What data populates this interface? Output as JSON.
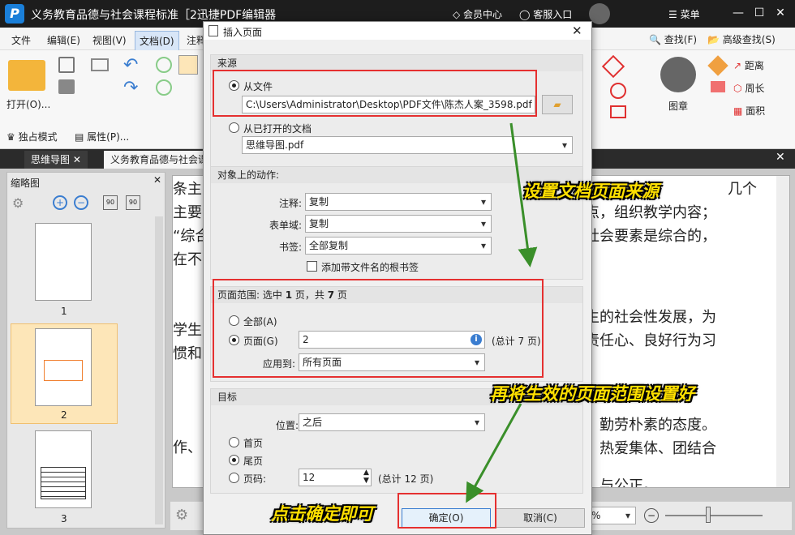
{
  "window": {
    "title": "义务教育品德与社会课程标准［2迅捷PDF编辑器",
    "vip_center": "会员中心",
    "service": "客服入口",
    "menu_label": "菜单"
  },
  "menubar": {
    "items": [
      "文件",
      "编辑(E)",
      "视图(V)",
      "文档(D)",
      "注释"
    ]
  },
  "ribbon": {
    "open_label": "打开(O)...",
    "solo_mode": "独占模式",
    "properties": "属性(P)...",
    "stamp_label": "图章",
    "find": "查找(F)",
    "advanced_find": "高级查找(S)",
    "distance": "距离",
    "perimeter": "周长",
    "area": "面积"
  },
  "tabs": [
    "思维导图",
    "义务教育品德与社会课"
  ],
  "left_pane": {
    "title": "缩略图",
    "pages": [
      "1",
      "2",
      "3"
    ]
  },
  "document_lines": [
    "条主",
    "主要",
    "“综合",
    "在不",
    "学生",
    "惯和",
    "作、"
  ],
  "document_right_lines": [
    "几个",
    "点，组织教学内容；",
    "社会要素是综合的，",
    "生的社会性发展，为",
    "责任心、良好行为习",
    "勤劳朴素的态度。",
    "热爱集体、团结合",
    "与公正。"
  ],
  "status": {
    "zoom": "%"
  },
  "dialog": {
    "title": "插入页面",
    "source_group": "来源",
    "from_file": "从文件",
    "file_path": "C:\\Users\\Administrator\\Desktop\\PDF文件\\陈杰人案_3598.pdf",
    "from_open_doc": "从已打开的文档",
    "open_doc_value": "思维导图.pdf",
    "actions_group": "对象上的动作:",
    "annotation_label": "注释:",
    "annotation_value": "复制",
    "form_label": "表单域:",
    "form_value": "复制",
    "bookmark_label": "书签:",
    "bookmark_value": "全部复制",
    "root_bookmark": "添加带文件名的根书签",
    "range_prefix": "页面范围: 选中",
    "range_selected": "1",
    "range_mid": "页，共",
    "range_total": "7",
    "range_suffix": "页",
    "all_label": "全部(A)",
    "pages_label": "页面(G)",
    "pages_value": "2",
    "pages_total": "(总计 7 页)",
    "apply_label": "应用到:",
    "apply_value": "所有页面",
    "target_group": "目标",
    "position_label": "位置:",
    "position_value": "之后",
    "first_page": "首页",
    "last_page": "尾页",
    "page_num": "页码:",
    "page_num_value": "12",
    "page_num_total": "(总计 12 页)",
    "ok": "确定(O)",
    "cancel": "取消(C)"
  },
  "annotations": {
    "a1": "设置文档页面来源",
    "a2": "再将生效的页面范围设置好",
    "a3": "点击确定即可"
  }
}
